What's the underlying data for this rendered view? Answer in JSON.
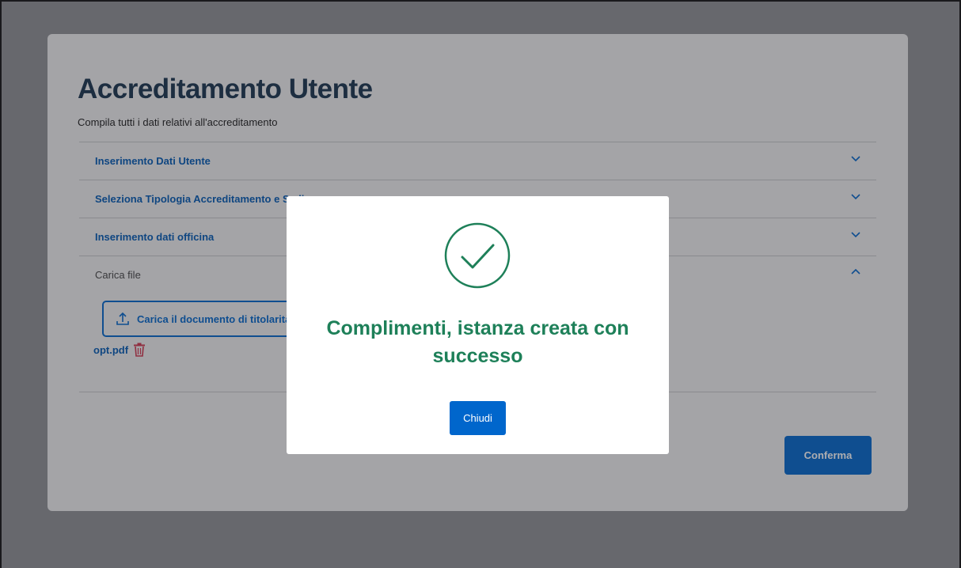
{
  "page": {
    "title": "Accreditamento Utente",
    "subtitle": "Compila tutti i dati relativi all'accreditamento"
  },
  "accordion": {
    "items": [
      {
        "label": "Inserimento Dati Utente",
        "expanded": false
      },
      {
        "label": "Seleziona Tipologia Accreditamento e Sedi",
        "expanded": false
      },
      {
        "label": "Inserimento dati officina",
        "expanded": false
      },
      {
        "label": "Carica file",
        "expanded": true
      }
    ]
  },
  "upload": {
    "button_label": "Carica il documento di titolarità",
    "file_name": "opt.pdf"
  },
  "actions": {
    "confirm_label": "Conferma"
  },
  "modal": {
    "message": "Complimenti, istanza creata con successo",
    "close_label": "Chiudi"
  },
  "colors": {
    "primary": "#0066cc",
    "success": "#1e8059",
    "danger": "#d1344c",
    "title": "#17324d"
  },
  "icons": {
    "accordion_collapsed": "chevron-down-icon",
    "accordion_expanded": "chevron-up-icon",
    "upload": "upload-icon",
    "delete": "trash-icon",
    "success": "check-circle-icon"
  }
}
